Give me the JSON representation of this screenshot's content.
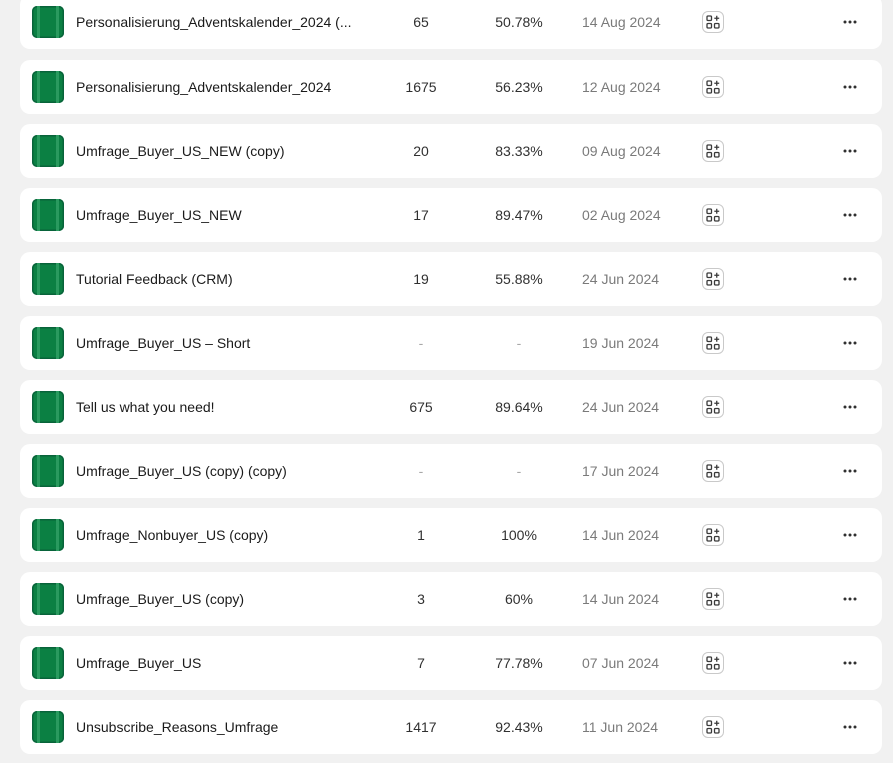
{
  "rows": [
    {
      "name": "Personalisierung_Adventskalender_2024 (...",
      "responses": "65",
      "rate": "50.78%",
      "date": "14 Aug 2024"
    },
    {
      "name": "Personalisierung_Adventskalender_2024",
      "responses": "1675",
      "rate": "56.23%",
      "date": "12 Aug 2024"
    },
    {
      "name": "Umfrage_Buyer_US_NEW (copy)",
      "responses": "20",
      "rate": "83.33%",
      "date": "09 Aug 2024"
    },
    {
      "name": "Umfrage_Buyer_US_NEW",
      "responses": "17",
      "rate": "89.47%",
      "date": "02 Aug 2024"
    },
    {
      "name": "Tutorial Feedback (CRM)",
      "responses": "19",
      "rate": "55.88%",
      "date": "24 Jun 2024"
    },
    {
      "name": "Umfrage_Buyer_US – Short",
      "responses": "-",
      "rate": "-",
      "date": "19 Jun 2024"
    },
    {
      "name": "Tell us what you need!",
      "responses": "675",
      "rate": "89.64%",
      "date": "24 Jun 2024"
    },
    {
      "name": "Umfrage_Buyer_US (copy) (copy)",
      "responses": "-",
      "rate": "-",
      "date": "17 Jun 2024"
    },
    {
      "name": "Umfrage_Nonbuyer_US (copy)",
      "responses": "1",
      "rate": "100%",
      "date": "14 Jun 2024"
    },
    {
      "name": "Umfrage_Buyer_US (copy)",
      "responses": "3",
      "rate": "60%",
      "date": "14 Jun 2024"
    },
    {
      "name": "Umfrage_Buyer_US",
      "responses": "7",
      "rate": "77.78%",
      "date": "07 Jun 2024"
    },
    {
      "name": "Unsubscribe_Reasons_Umfrage",
      "responses": "1417",
      "rate": "92.43%",
      "date": "11 Jun 2024"
    }
  ],
  "icons": {
    "thumbnail": "survey-thumbnail-icon",
    "add": "add-to-app-icon",
    "more": "more-actions-icon"
  },
  "colors": {
    "thumbnail_green": "#0b8043",
    "background": "#f1f1f1",
    "row_background": "#ffffff"
  }
}
